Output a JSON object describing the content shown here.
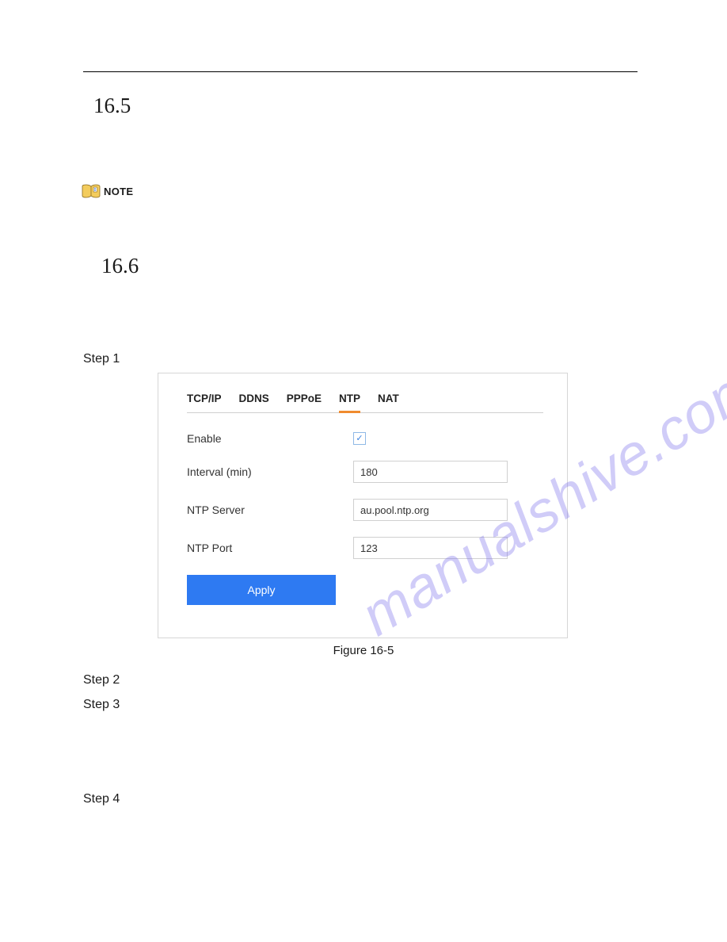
{
  "sections": {
    "s165": "16.5",
    "s166": "16.6"
  },
  "note_label": "NOTE",
  "steps": {
    "s1": "Step 1",
    "s2": "Step 2",
    "s3": "Step 3",
    "s4": "Step 4"
  },
  "ui": {
    "tabs": {
      "tcpip": "TCP/IP",
      "ddns": "DDNS",
      "pppoe": "PPPoE",
      "ntp": "NTP",
      "nat": "NAT"
    },
    "labels": {
      "enable": "Enable",
      "interval": "Interval (min)",
      "ntp_server": "NTP Server",
      "ntp_port": "NTP Port"
    },
    "values": {
      "enable_checked": "✓",
      "interval": "180",
      "ntp_server": "au.pool.ntp.org",
      "ntp_port": "123"
    },
    "apply": "Apply"
  },
  "figure_caption": "Figure 16-5",
  "watermark": "manualshive.com"
}
